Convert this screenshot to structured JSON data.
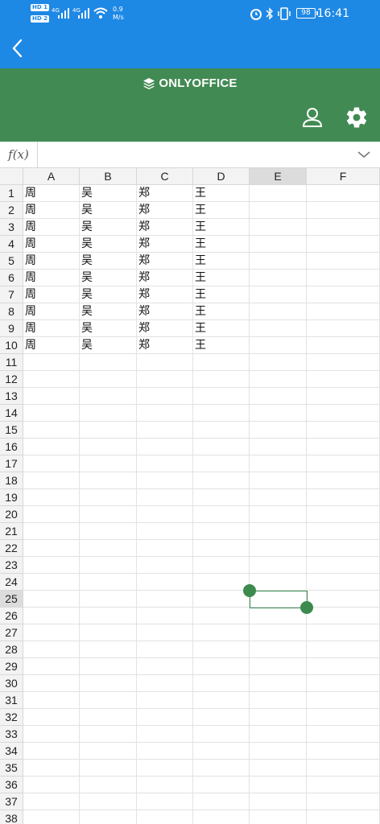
{
  "status_bar": {
    "hd1": "HD 1",
    "hd2": "HD 2",
    "net1": "4G",
    "net2": "4G",
    "speed_value": "0.9",
    "speed_unit": "M/s",
    "battery": "98",
    "time": "16:41"
  },
  "app": {
    "logo_text": "ONLYOFFICE",
    "accent": "#428a53",
    "nav_color": "#1e88e5"
  },
  "formula_bar": {
    "fx_label": "f(x)",
    "value": ""
  },
  "sheet": {
    "columns": [
      "A",
      "B",
      "C",
      "D",
      "E",
      "F"
    ],
    "selected_column": "E",
    "selected_row": "25",
    "rows": [
      {
        "num": "1",
        "cells": [
          "周",
          "吴",
          "郑",
          "王",
          "",
          ""
        ]
      },
      {
        "num": "2",
        "cells": [
          "周",
          "吴",
          "郑",
          "王",
          "",
          ""
        ]
      },
      {
        "num": "3",
        "cells": [
          "周",
          "吴",
          "郑",
          "王",
          "",
          ""
        ]
      },
      {
        "num": "4",
        "cells": [
          "周",
          "吴",
          "郑",
          "王",
          "",
          ""
        ]
      },
      {
        "num": "5",
        "cells": [
          "周",
          "吴",
          "郑",
          "王",
          "",
          ""
        ]
      },
      {
        "num": "6",
        "cells": [
          "周",
          "吴",
          "郑",
          "王",
          "",
          ""
        ]
      },
      {
        "num": "7",
        "cells": [
          "周",
          "吴",
          "郑",
          "王",
          "",
          ""
        ]
      },
      {
        "num": "8",
        "cells": [
          "周",
          "吴",
          "郑",
          "王",
          "",
          ""
        ]
      },
      {
        "num": "9",
        "cells": [
          "周",
          "吴",
          "郑",
          "王",
          "",
          ""
        ]
      },
      {
        "num": "10",
        "cells": [
          "周",
          "吴",
          "郑",
          "王",
          "",
          ""
        ]
      },
      {
        "num": "11",
        "cells": [
          "",
          "",
          "",
          "",
          "",
          ""
        ]
      },
      {
        "num": "12",
        "cells": [
          "",
          "",
          "",
          "",
          "",
          ""
        ]
      },
      {
        "num": "13",
        "cells": [
          "",
          "",
          "",
          "",
          "",
          ""
        ]
      },
      {
        "num": "14",
        "cells": [
          "",
          "",
          "",
          "",
          "",
          ""
        ]
      },
      {
        "num": "15",
        "cells": [
          "",
          "",
          "",
          "",
          "",
          ""
        ]
      },
      {
        "num": "16",
        "cells": [
          "",
          "",
          "",
          "",
          "",
          ""
        ]
      },
      {
        "num": "17",
        "cells": [
          "",
          "",
          "",
          "",
          "",
          ""
        ]
      },
      {
        "num": "18",
        "cells": [
          "",
          "",
          "",
          "",
          "",
          ""
        ]
      },
      {
        "num": "19",
        "cells": [
          "",
          "",
          "",
          "",
          "",
          ""
        ]
      },
      {
        "num": "20",
        "cells": [
          "",
          "",
          "",
          "",
          "",
          ""
        ]
      },
      {
        "num": "21",
        "cells": [
          "",
          "",
          "",
          "",
          "",
          ""
        ]
      },
      {
        "num": "22",
        "cells": [
          "",
          "",
          "",
          "",
          "",
          ""
        ]
      },
      {
        "num": "23",
        "cells": [
          "",
          "",
          "",
          "",
          "",
          ""
        ]
      },
      {
        "num": "24",
        "cells": [
          "",
          "",
          "",
          "",
          "",
          ""
        ]
      },
      {
        "num": "25",
        "cells": [
          "",
          "",
          "",
          "",
          "",
          ""
        ]
      },
      {
        "num": "26",
        "cells": [
          "",
          "",
          "",
          "",
          "",
          ""
        ]
      },
      {
        "num": "27",
        "cells": [
          "",
          "",
          "",
          "",
          "",
          ""
        ]
      },
      {
        "num": "28",
        "cells": [
          "",
          "",
          "",
          "",
          "",
          ""
        ]
      },
      {
        "num": "29",
        "cells": [
          "",
          "",
          "",
          "",
          "",
          ""
        ]
      },
      {
        "num": "30",
        "cells": [
          "",
          "",
          "",
          "",
          "",
          ""
        ]
      },
      {
        "num": "31",
        "cells": [
          "",
          "",
          "",
          "",
          "",
          ""
        ]
      },
      {
        "num": "32",
        "cells": [
          "",
          "",
          "",
          "",
          "",
          ""
        ]
      },
      {
        "num": "33",
        "cells": [
          "",
          "",
          "",
          "",
          "",
          ""
        ]
      },
      {
        "num": "34",
        "cells": [
          "",
          "",
          "",
          "",
          "",
          ""
        ]
      },
      {
        "num": "35",
        "cells": [
          "",
          "",
          "",
          "",
          "",
          ""
        ]
      },
      {
        "num": "36",
        "cells": [
          "",
          "",
          "",
          "",
          "",
          ""
        ]
      },
      {
        "num": "37",
        "cells": [
          "",
          "",
          "",
          "",
          "",
          ""
        ]
      },
      {
        "num": "38",
        "cells": [
          "",
          "",
          "",
          "",
          "",
          ""
        ]
      }
    ]
  },
  "icons": {
    "back": "chevron-left-icon",
    "user": "user-icon",
    "settings": "gear-icon",
    "expand": "chevron-down-icon",
    "logo": "layers-icon"
  }
}
